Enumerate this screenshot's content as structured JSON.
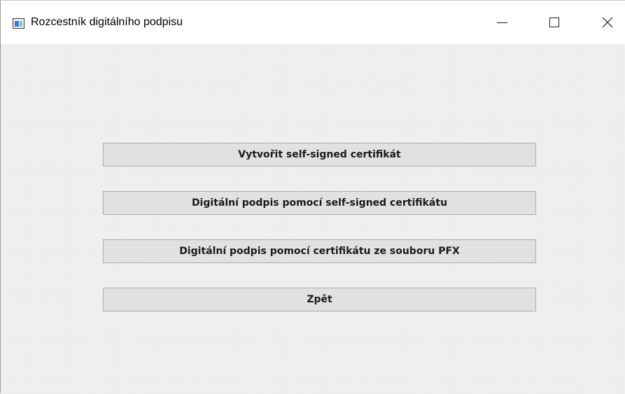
{
  "window": {
    "title": "Rozcestník digitálního podpisu",
    "icon": "application-window-icon",
    "controls": {
      "minimize_glyph": "—",
      "maximize_glyph": "☐",
      "close_glyph": "✕"
    }
  },
  "buttons": [
    {
      "label": "Vytvořit self-signed certifikát"
    },
    {
      "label": "Digitální podpis pomocí self-signed certifikátu"
    },
    {
      "label": "Digitální podpis pomocí certifikátu ze souboru PFX"
    },
    {
      "label": "Zpět"
    }
  ],
  "colors": {
    "window_background": "#f0f0f0",
    "button_face": "#e1e1e1",
    "button_border": "#adadad",
    "titlebar": "#ffffff"
  }
}
